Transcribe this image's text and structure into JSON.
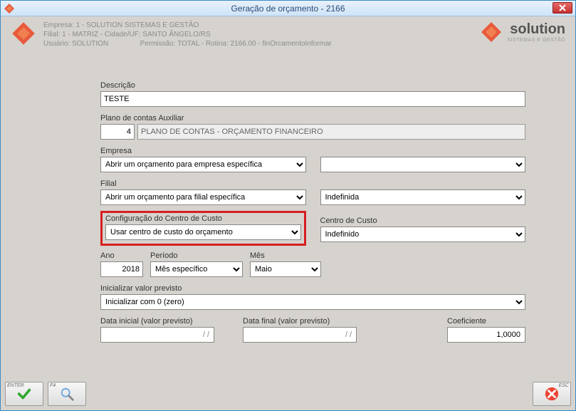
{
  "window": {
    "title": "Geração de orçamento - 2166"
  },
  "header": {
    "empresa": "Empresa: 1 - SOLUTION SISTEMAS E GESTÃO",
    "filial": "Filial: 1 - MATRIZ - Cidade/UF: SANTO ÂNGELO/RS",
    "usuario": "Usuário: SOLUTION",
    "permissao": "Permissão: TOTAL - Rotina: 2166.00 - finOrcamentoInformar",
    "brand": "solution",
    "brand_tag": "SISTEMAS E GESTÃO"
  },
  "labels": {
    "descricao": "Descrição",
    "plano_contas": "Plano de contas Auxiliar",
    "empresa": "Empresa",
    "filial": "Filial",
    "config_cc": "Configuração do Centro de Custo",
    "centro_custo": "Centro de Custo",
    "ano": "Ano",
    "periodo": "Período",
    "mes": "Mês",
    "inicializar": "Inicializar valor previsto",
    "data_inicial": "Data inicial (valor previsto)",
    "data_final": "Data final (valor previsto)",
    "coeficiente": "Coeficiente"
  },
  "values": {
    "descricao": "TESTE",
    "plano_num": "4",
    "plano_desc": "PLANO DE CONTAS - ORÇAMENTO FINANCEIRO",
    "empresa_sel": "Abrir um orçamento para empresa específica",
    "empresa2_sel": "",
    "filial_sel": "Abrir um orçamento para filial específica",
    "filial2_sel": "Indefinida",
    "config_cc_sel": "Usar centro de custo do orçamento",
    "cc_sel": "Indefinido",
    "ano": "2018",
    "periodo_sel": "Mês específico",
    "mes_sel": "Maio",
    "inicializar_sel": "Inicializar com 0 (zero)",
    "data_inicial": "  /  /",
    "data_final": "  /  /",
    "coeficiente": "1,0000"
  },
  "buttons": {
    "enter": "ENTER",
    "f4": "F4",
    "esc": "ESC"
  }
}
